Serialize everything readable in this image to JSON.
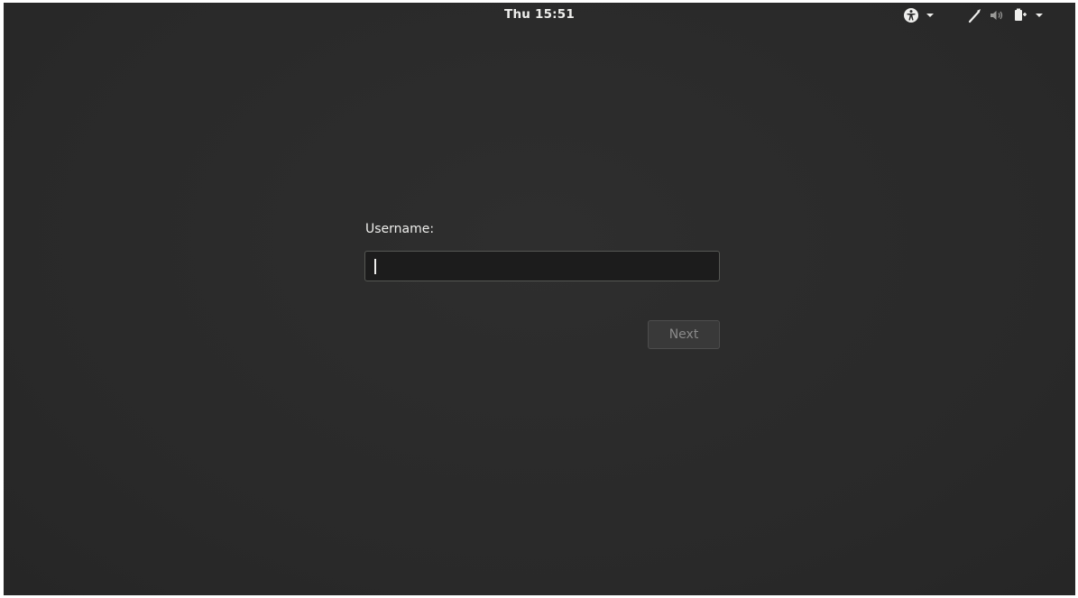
{
  "topbar": {
    "clock": "Thu 15:51",
    "icons": {
      "accessibility": "accessibility-icon",
      "network": "wired-network-icon",
      "volume": "volume-icon",
      "power": "power-battery-icon"
    }
  },
  "login": {
    "username_label": "Username:",
    "username_value": "",
    "next_label": "Next"
  },
  "colors": {
    "background": "#2b2b2b",
    "text": "#eeeeec",
    "input_bg": "#1c1c1c",
    "button_text_disabled": "#8a8a8a"
  }
}
